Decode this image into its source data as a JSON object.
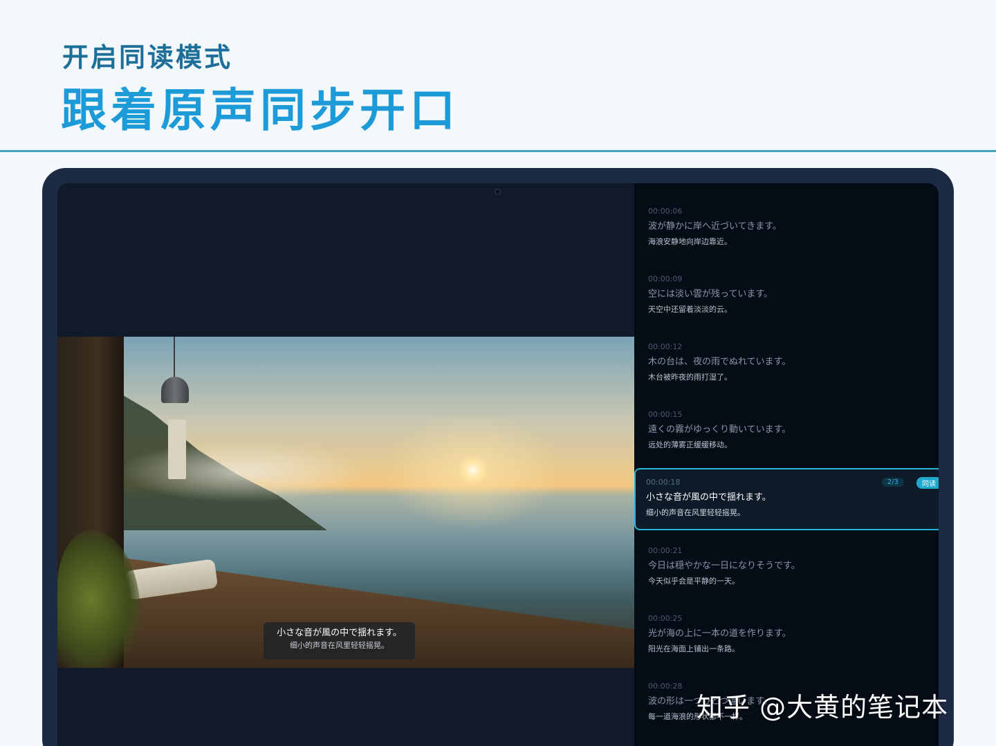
{
  "header": {
    "subtitle": "开启同读模式",
    "title": "跟着原声同步开口"
  },
  "player": {
    "caption_jp": "小さな音が風の中で揺れます。",
    "caption_cn": "细小的声音在风里轻轻摇晃。"
  },
  "transcript": {
    "items": [
      {
        "time": "00:00:06",
        "jp": "波が静かに岸へ近づいてきます。",
        "cn": "海浪安静地向岸边靠近。"
      },
      {
        "time": "00:00:09",
        "jp": "空には淡い雲が残っています。",
        "cn": "天空中还留着淡淡的云。"
      },
      {
        "time": "00:00:12",
        "jp": "木の台は、夜の雨でぬれています。",
        "cn": "木台被昨夜的雨打湿了。"
      },
      {
        "time": "00:00:15",
        "jp": "遠くの霧がゆっくり動いています。",
        "cn": "远处的薄雾正缓缓移动。"
      },
      {
        "time": "00:00:18",
        "jp": "小さな音が風の中で揺れます。",
        "cn": "细小的声音在风里轻轻摇晃。",
        "count": "2/3",
        "mode": "同读"
      },
      {
        "time": "00:00:21",
        "jp": "今日は穏やかな一日になりそうです。",
        "cn": "今天似乎会是平静的一天。"
      },
      {
        "time": "00:00:25",
        "jp": "光が海の上に一本の道を作ります。",
        "cn": "阳光在海面上铺出一条路。"
      },
      {
        "time": "00:00:28",
        "jp": "波の形は一つひとつ違います。",
        "cn": "每一道海浪的形状都不一样。"
      }
    ]
  },
  "watermark": "知乎 @大黄的笔记本",
  "colors": {
    "accent": "#25b7d6",
    "title": "#1d9ad8",
    "tablet_frame": "#1c2a44"
  }
}
